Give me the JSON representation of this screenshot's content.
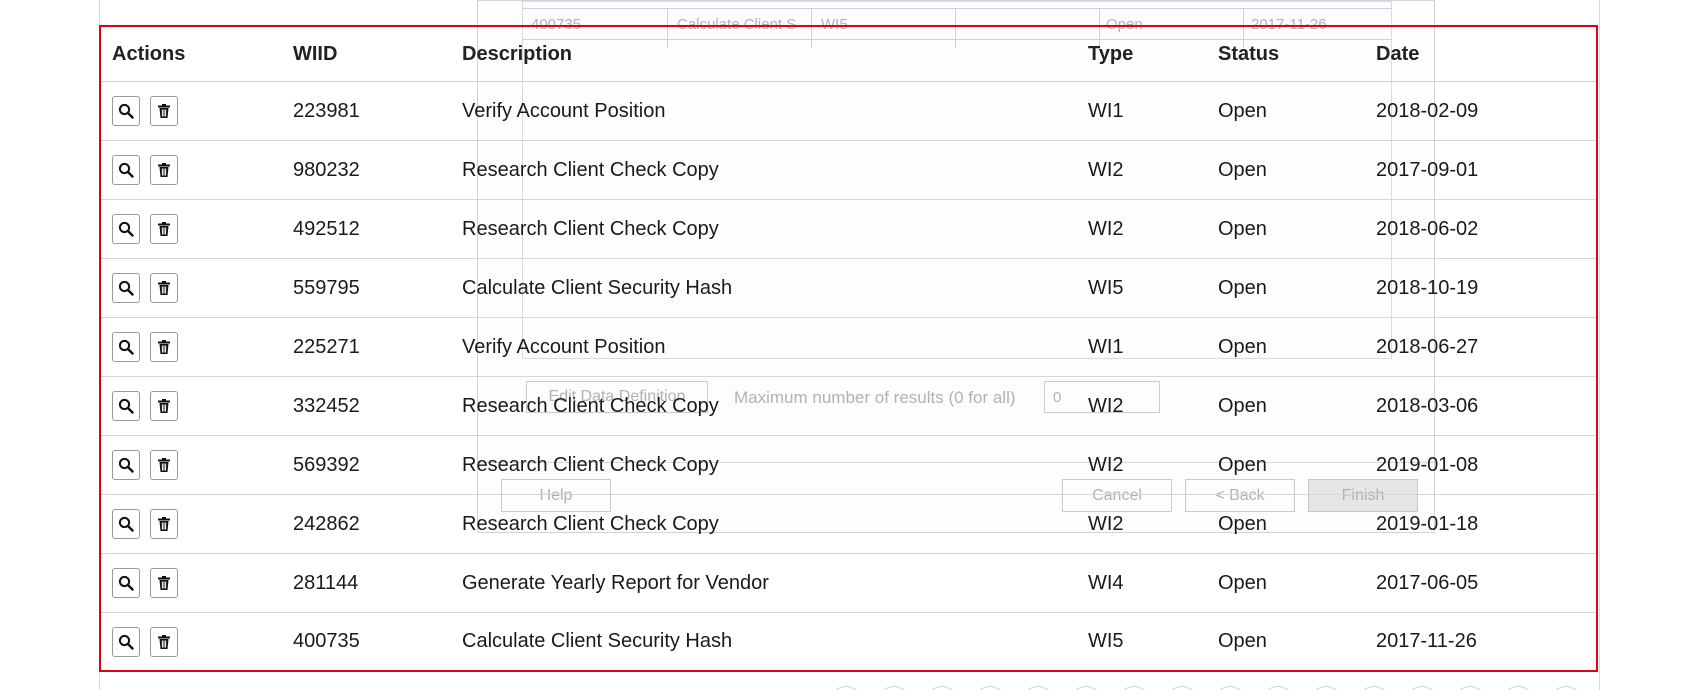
{
  "table": {
    "headers": {
      "actions": "Actions",
      "wiid": "WIID",
      "description": "Description",
      "type": "Type",
      "status": "Status",
      "date": "Date"
    },
    "rows": [
      {
        "wiid": "223981",
        "description": "Verify Account Position",
        "type": "WI1",
        "status": "Open",
        "date": "2018-02-09"
      },
      {
        "wiid": "980232",
        "description": "Research Client Check Copy",
        "type": "WI2",
        "status": "Open",
        "date": "2017-09-01"
      },
      {
        "wiid": "492512",
        "description": "Research Client Check Copy",
        "type": "WI2",
        "status": "Open",
        "date": "2018-06-02"
      },
      {
        "wiid": "559795",
        "description": "Calculate Client Security Hash",
        "type": "WI5",
        "status": "Open",
        "date": "2018-10-19"
      },
      {
        "wiid": "225271",
        "description": "Verify Account Position",
        "type": "WI1",
        "status": "Open",
        "date": "2018-06-27"
      },
      {
        "wiid": "332452",
        "description": "Research Client Check Copy",
        "type": "WI2",
        "status": "Open",
        "date": "2018-03-06"
      },
      {
        "wiid": "569392",
        "description": "Research Client Check Copy",
        "type": "WI2",
        "status": "Open",
        "date": "2019-01-08"
      },
      {
        "wiid": "242862",
        "description": "Research Client Check Copy",
        "type": "WI2",
        "status": "Open",
        "date": "2019-01-18"
      },
      {
        "wiid": "281144",
        "description": "Generate Yearly Report for Vendor",
        "type": "WI4",
        "status": "Open",
        "date": "2017-06-05"
      },
      {
        "wiid": "400735",
        "description": "Calculate Client Security Hash",
        "type": "WI5",
        "status": "Open",
        "date": "2017-11-26"
      }
    ],
    "row_actions": [
      "search-icon",
      "trash-icon"
    ],
    "highlight_color": "#e0001a"
  },
  "ghost_dialog": {
    "row": {
      "wiid": "400735",
      "description": "Calculate Client S",
      "type": "WI5",
      "status": "Open",
      "date": "2017-11-26"
    },
    "edit_button": "Edit Data Definition",
    "max_results_label": "Maximum number of results (0 for all)",
    "max_results_value": "0",
    "help_button": "Help",
    "cancel_button": "Cancel",
    "back_button": "< Back",
    "finish_button": "Finish"
  }
}
